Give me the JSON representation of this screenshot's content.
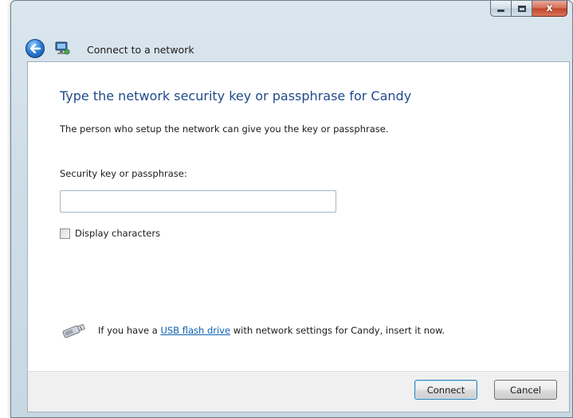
{
  "window": {
    "caption_buttons": [
      "minimize",
      "maximize",
      "close"
    ],
    "close_glyph": "x"
  },
  "header": {
    "title": "Connect to a network",
    "back_icon": "back-arrow-icon",
    "app_icon": "network-icon"
  },
  "main": {
    "heading": "Type the network security key or passphrase for Candy",
    "description": "The person who setup the network can give you the key or passphrase.",
    "key_label": "Security key or passphrase:",
    "key_value": "",
    "display_characters_label": "Display characters",
    "display_characters_checked": false,
    "usb": {
      "icon": "usb-drive-icon",
      "prefix": "If you have a ",
      "link_text": "USB flash drive",
      "suffix": " with network settings for Candy, insert it now."
    }
  },
  "footer": {
    "connect_label": "Connect",
    "cancel_label": "Cancel"
  },
  "colors": {
    "heading": "#1f4a8a",
    "link": "#0c5fb0",
    "close_button": "#c2432a",
    "window_frame": "#cfdde7"
  }
}
